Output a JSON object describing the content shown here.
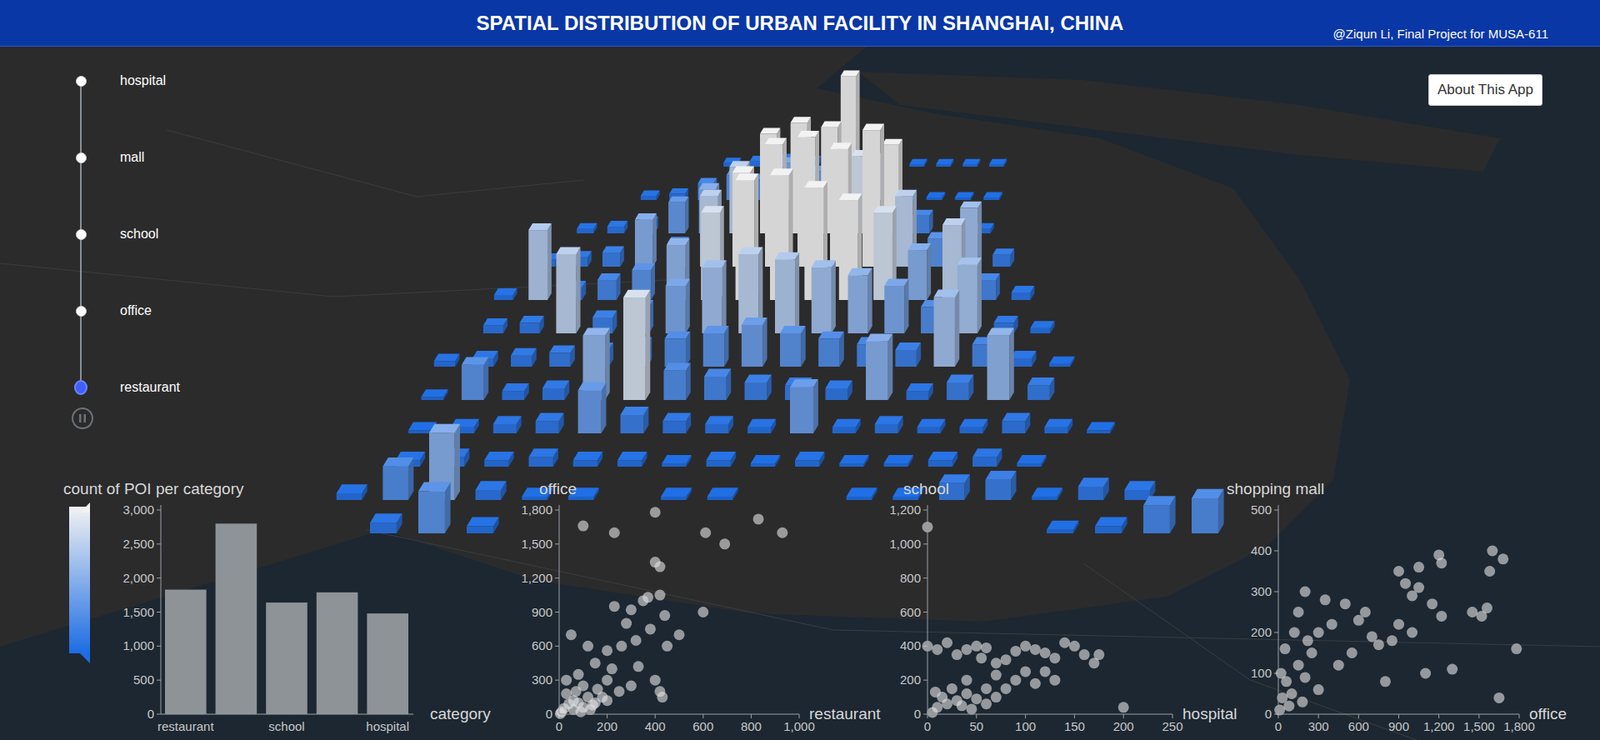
{
  "header": {
    "title": "SPATIAL DISTRIBUTION OF URBAN FACILITY IN SHANGHAI, CHINA",
    "credit": "@Ziqun Li, Final Project for MUSA-611"
  },
  "about_button": {
    "label": "About This App"
  },
  "timeline": {
    "playing": true,
    "items": [
      {
        "label": "hospital",
        "selected": false
      },
      {
        "label": "mall",
        "selected": false
      },
      {
        "label": "school",
        "selected": false
      },
      {
        "label": "office",
        "selected": false
      },
      {
        "label": "restaurant",
        "selected": true
      }
    ]
  },
  "map": {
    "grid": [
      [
        0,
        0,
        0,
        0,
        0,
        0,
        0,
        0,
        0,
        2,
        3,
        4,
        3,
        2,
        0,
        0,
        1,
        1,
        1,
        1
      ],
      [
        0,
        0,
        0,
        0,
        0,
        0,
        2,
        3,
        8,
        12,
        10,
        18,
        14,
        60,
        20,
        2,
        1,
        1,
        1,
        0
      ],
      [
        0,
        0,
        0,
        0,
        2,
        3,
        5,
        14,
        20,
        30,
        45,
        50,
        48,
        35,
        40,
        8,
        3,
        2,
        0,
        0
      ],
      [
        0,
        0,
        0,
        3,
        4,
        6,
        20,
        10,
        30,
        40,
        52,
        55,
        50,
        58,
        30,
        12,
        25,
        5,
        0,
        0
      ],
      [
        0,
        0,
        2,
        28,
        5,
        8,
        12,
        22,
        35,
        48,
        50,
        45,
        40,
        35,
        20,
        30,
        8,
        3,
        0,
        0
      ],
      [
        0,
        0,
        3,
        4,
        30,
        6,
        10,
        18,
        25,
        30,
        28,
        25,
        22,
        18,
        10,
        26,
        4,
        2,
        0,
        0
      ],
      [
        0,
        2,
        3,
        4,
        5,
        6,
        8,
        10,
        12,
        15,
        12,
        10,
        8,
        6,
        25,
        8,
        3,
        1,
        0,
        0
      ],
      [
        0,
        1,
        12,
        3,
        4,
        22,
        35,
        10,
        8,
        6,
        5,
        4,
        20,
        3,
        6,
        22,
        5,
        0,
        0,
        0
      ],
      [
        0,
        1,
        2,
        3,
        4,
        14,
        6,
        4,
        3,
        2,
        15,
        2,
        3,
        2,
        2,
        4,
        2,
        1,
        0,
        0
      ],
      [
        0,
        2,
        3,
        2,
        3,
        2,
        2,
        1,
        2,
        1,
        2,
        1,
        1,
        2,
        3,
        1,
        0,
        0,
        0,
        0
      ],
      [
        2,
        10,
        20,
        3,
        1,
        1,
        0,
        1,
        1,
        0,
        0,
        1,
        1,
        5,
        6,
        1,
        4,
        3,
        0,
        0
      ],
      [
        0,
        3,
        12,
        2,
        0,
        0,
        0,
        0,
        0,
        0,
        0,
        0,
        0,
        0,
        0,
        1,
        2,
        8,
        10,
        0
      ]
    ]
  },
  "bar_chart": {
    "title": "count of POI per category",
    "axis_label": "category",
    "y_max": 3000,
    "y_ticks": [
      "0",
      "500",
      "1,000",
      "1,500",
      "2,000",
      "2,500",
      "3,000"
    ],
    "bars": [
      {
        "value": 1830,
        "tick": "restaurant"
      },
      {
        "value": 2800,
        "tick": ""
      },
      {
        "value": 1640,
        "tick": "school"
      },
      {
        "value": 1790,
        "tick": ""
      },
      {
        "value": 1480,
        "tick": "hospital"
      }
    ]
  },
  "scatters": [
    {
      "title": "office",
      "x_label": "restaurant",
      "x_max": 1000,
      "y_max": 1800,
      "x_ticks": [
        "0",
        "200",
        "400",
        "600",
        "800",
        "1,000"
      ],
      "y_ticks": [
        "0",
        "300",
        "600",
        "900",
        "1,200",
        "1,500",
        "1,800"
      ],
      "points": [
        [
          100,
          1660
        ],
        [
          230,
          1600
        ],
        [
          400,
          1780
        ],
        [
          830,
          1720
        ],
        [
          930,
          1600
        ],
        [
          610,
          1600
        ],
        [
          690,
          1500
        ],
        [
          400,
          1340
        ],
        [
          420,
          1300
        ],
        [
          420,
          1050
        ],
        [
          370,
          1030
        ],
        [
          350,
          1000
        ],
        [
          300,
          920
        ],
        [
          230,
          950
        ],
        [
          280,
          800
        ],
        [
          440,
          870
        ],
        [
          600,
          900
        ],
        [
          380,
          750
        ],
        [
          320,
          650
        ],
        [
          450,
          600
        ],
        [
          500,
          700
        ],
        [
          260,
          600
        ],
        [
          200,
          560
        ],
        [
          330,
          420
        ],
        [
          400,
          300
        ],
        [
          430,
          150
        ],
        [
          420,
          200
        ],
        [
          300,
          250
        ],
        [
          150,
          450
        ],
        [
          120,
          600
        ],
        [
          50,
          700
        ],
        [
          200,
          300
        ],
        [
          250,
          200
        ],
        [
          100,
          250
        ],
        [
          180,
          150
        ],
        [
          60,
          120
        ],
        [
          140,
          80
        ],
        [
          30,
          300
        ],
        [
          80,
          350
        ],
        [
          220,
          400
        ],
        [
          10,
          20
        ],
        [
          20,
          50
        ],
        [
          40,
          90
        ],
        [
          60,
          40
        ],
        [
          80,
          100
        ],
        [
          100,
          60
        ],
        [
          120,
          150
        ],
        [
          150,
          100
        ],
        [
          30,
          180
        ],
        [
          70,
          200
        ],
        [
          160,
          220
        ],
        [
          200,
          120
        ],
        [
          5,
          5
        ],
        [
          90,
          20
        ],
        [
          130,
          40
        ]
      ]
    },
    {
      "title": "school",
      "x_label": "hospital",
      "x_max": 250,
      "y_max": 1200,
      "x_ticks": [
        "0",
        "50",
        "100",
        "150",
        "200",
        "250"
      ],
      "y_ticks": [
        "0",
        "200",
        "400",
        "600",
        "800",
        "1,000",
        "1,200"
      ],
      "points": [
        [
          0,
          1100
        ],
        [
          0,
          400
        ],
        [
          10,
          380
        ],
        [
          20,
          420
        ],
        [
          30,
          350
        ],
        [
          40,
          380
        ],
        [
          50,
          400
        ],
        [
          55,
          330
        ],
        [
          60,
          390
        ],
        [
          70,
          300
        ],
        [
          80,
          320
        ],
        [
          90,
          370
        ],
        [
          100,
          400
        ],
        [
          110,
          380
        ],
        [
          120,
          360
        ],
        [
          130,
          330
        ],
        [
          140,
          420
        ],
        [
          150,
          400
        ],
        [
          160,
          350
        ],
        [
          170,
          300
        ],
        [
          175,
          350
        ],
        [
          200,
          40
        ],
        [
          100,
          250
        ],
        [
          120,
          250
        ],
        [
          90,
          200
        ],
        [
          70,
          230
        ],
        [
          60,
          150
        ],
        [
          40,
          200
        ],
        [
          80,
          150
        ],
        [
          110,
          180
        ],
        [
          130,
          200
        ],
        [
          5,
          10
        ],
        [
          10,
          40
        ],
        [
          20,
          60
        ],
        [
          30,
          80
        ],
        [
          15,
          100
        ],
        [
          40,
          120
        ],
        [
          25,
          150
        ],
        [
          50,
          90
        ],
        [
          35,
          50
        ],
        [
          8,
          130
        ],
        [
          45,
          30
        ],
        [
          60,
          60
        ],
        [
          70,
          100
        ]
      ]
    },
    {
      "title": "shopping mall",
      "x_label": "office",
      "x_max": 1800,
      "y_max": 500,
      "x_ticks": [
        "0",
        "300",
        "600",
        "900",
        "1,200",
        "1,500",
        "1,800"
      ],
      "y_ticks": [
        "0",
        "100",
        "200",
        "300",
        "400",
        "500"
      ],
      "points": [
        [
          1200,
          390
        ],
        [
          1220,
          370
        ],
        [
          1600,
          400
        ],
        [
          1680,
          380
        ],
        [
          1580,
          350
        ],
        [
          1050,
          360
        ],
        [
          900,
          350
        ],
        [
          950,
          320
        ],
        [
          1050,
          310
        ],
        [
          1000,
          290
        ],
        [
          1150,
          270
        ],
        [
          1220,
          240
        ],
        [
          1450,
          250
        ],
        [
          1520,
          240
        ],
        [
          1560,
          260
        ],
        [
          1780,
          160
        ],
        [
          1650,
          40
        ],
        [
          1300,
          110
        ],
        [
          1100,
          100
        ],
        [
          800,
          80
        ],
        [
          700,
          190
        ],
        [
          750,
          170
        ],
        [
          850,
          180
        ],
        [
          600,
          230
        ],
        [
          650,
          250
        ],
        [
          500,
          270
        ],
        [
          400,
          220
        ],
        [
          300,
          200
        ],
        [
          550,
          150
        ],
        [
          450,
          120
        ],
        [
          900,
          220
        ],
        [
          1000,
          200
        ],
        [
          350,
          280
        ],
        [
          200,
          300
        ],
        [
          150,
          250
        ],
        [
          10,
          10
        ],
        [
          30,
          40
        ],
        [
          60,
          80
        ],
        [
          100,
          50
        ],
        [
          150,
          120
        ],
        [
          200,
          90
        ],
        [
          250,
          150
        ],
        [
          50,
          160
        ],
        [
          120,
          200
        ],
        [
          300,
          60
        ],
        [
          80,
          20
        ],
        [
          180,
          30
        ],
        [
          220,
          180
        ],
        [
          20,
          100
        ]
      ]
    }
  ]
}
